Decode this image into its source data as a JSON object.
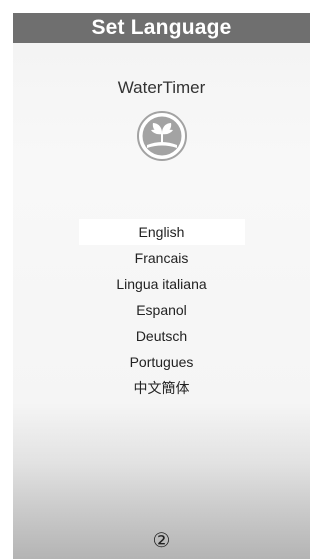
{
  "header": {
    "title": "Set Language"
  },
  "app": {
    "name": "WaterTimer",
    "logo_icon": "plant-sprout-icon"
  },
  "languages": {
    "selected_index": 0,
    "items": [
      {
        "label": "English"
      },
      {
        "label": "Francais"
      },
      {
        "label": "Lingua italiana"
      },
      {
        "label": "Espanol"
      },
      {
        "label": "Deutsch"
      },
      {
        "label": "Portugues"
      },
      {
        "label": "中文簡体"
      }
    ]
  },
  "footer": {
    "page_indicator": "②"
  },
  "colors": {
    "header_bg": "#6f6f6f",
    "header_text": "#ffffff",
    "selected_bg": "#ffffff",
    "logo_bg": "#a3a3a3"
  }
}
